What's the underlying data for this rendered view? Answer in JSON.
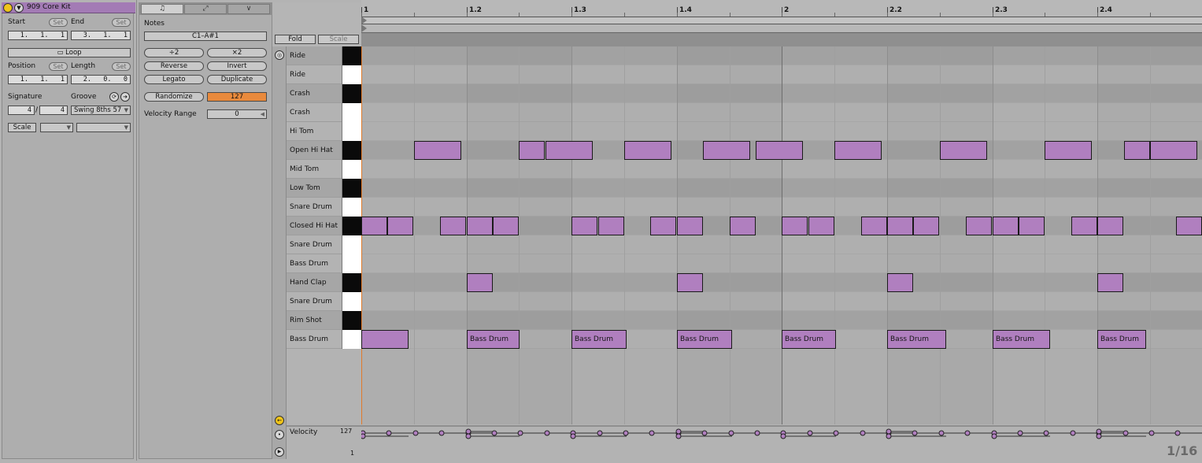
{
  "clip": {
    "title": "909 Core Kit",
    "start_label": "Start",
    "end_label": "End",
    "set": "Set",
    "start_value": "1.   1.   1",
    "end_value": "3.   1.   1",
    "loop_label": "Loop",
    "position_label": "Position",
    "length_label": "Length",
    "position_value": "1.   1.   1",
    "length_value": "2.   0.   0",
    "signature_label": "Signature",
    "groove_label": "Groove",
    "sig_num": "4",
    "sig_den": "4",
    "groove_value": "Swing 8ths 57",
    "scale_label": "Scale",
    "accent": "#a37bb5"
  },
  "notes_panel": {
    "tab_icons": [
      "music-note-icon",
      "expand-icon",
      "envelope-icon"
    ],
    "tab_glyphs": [
      "♫",
      "⤢",
      "∨"
    ],
    "notes_label": "Notes",
    "range_value": "C1–A#1",
    "div2": "÷2",
    "mul2": "×2",
    "reverse": "Reverse",
    "invert": "Invert",
    "legato": "Legato",
    "duplicate": "Duplicate",
    "randomize": "Randomize",
    "randomize_value": "127",
    "velocity_range_label": "Velocity Range",
    "velocity_range_value": "0"
  },
  "editor": {
    "fold": "Fold",
    "scale": "Scale",
    "ruler": [
      "1",
      "1.2",
      "1.3",
      "1.4",
      "2",
      "2.2",
      "2.3",
      "2.4"
    ],
    "grid_label": "1/16",
    "velocity_label": "Velocity",
    "velocity_max": "127",
    "velocity_min": "1"
  },
  "lanes": [
    {
      "name": "Ride",
      "key": "black"
    },
    {
      "name": "Ride",
      "key": "white"
    },
    {
      "name": "Crash",
      "key": "black"
    },
    {
      "name": "Crash",
      "key": "white"
    },
    {
      "name": "Hi Tom",
      "key": "white"
    },
    {
      "name": "Open Hi Hat",
      "key": "black"
    },
    {
      "name": "Mid Tom",
      "key": "white"
    },
    {
      "name": "Low Tom",
      "key": "black"
    },
    {
      "name": "Snare Drum",
      "key": "white"
    },
    {
      "name": "Closed Hi Hat",
      "key": "black"
    },
    {
      "name": "Snare Drum",
      "key": "white"
    },
    {
      "name": "Bass Drum",
      "key": "white"
    },
    {
      "name": "Hand Clap",
      "key": "black"
    },
    {
      "name": "Snare Drum",
      "key": "white"
    },
    {
      "name": "Rim Shot",
      "key": "black"
    },
    {
      "name": "Bass Drum",
      "key": "white"
    }
  ],
  "notes": [
    {
      "lane": 5,
      "start": 1.0,
      "len": 0.9
    },
    {
      "lane": 5,
      "start": 3.0,
      "len": 0.5
    },
    {
      "lane": 5,
      "start": 3.5,
      "len": 0.9
    },
    {
      "lane": 5,
      "start": 5.0,
      "len": 0.9
    },
    {
      "lane": 5,
      "start": 6.5,
      "len": 0.9
    },
    {
      "lane": 5,
      "start": 7.5,
      "len": 0.9
    },
    {
      "lane": 5,
      "start": 9.0,
      "len": 0.9
    },
    {
      "lane": 5,
      "start": 11.0,
      "len": 0.9
    },
    {
      "lane": 5,
      "start": 13.0,
      "len": 0.9
    },
    {
      "lane": 5,
      "start": 14.5,
      "len": 0.5
    },
    {
      "lane": 5,
      "start": 15.0,
      "len": 0.9
    },
    {
      "lane": 9,
      "start": 0.0,
      "len": 0.5
    },
    {
      "lane": 9,
      "start": 0.5,
      "len": 0.5
    },
    {
      "lane": 9,
      "start": 1.5,
      "len": 0.5
    },
    {
      "lane": 9,
      "start": 2.0,
      "len": 0.5
    },
    {
      "lane": 9,
      "start": 2.5,
      "len": 0.5
    },
    {
      "lane": 9,
      "start": 4.0,
      "len": 0.5
    },
    {
      "lane": 9,
      "start": 4.5,
      "len": 0.5
    },
    {
      "lane": 9,
      "start": 5.5,
      "len": 0.5
    },
    {
      "lane": 9,
      "start": 6.0,
      "len": 0.5
    },
    {
      "lane": 9,
      "start": 7.0,
      "len": 0.5
    },
    {
      "lane": 9,
      "start": 8.0,
      "len": 0.5
    },
    {
      "lane": 9,
      "start": 8.5,
      "len": 0.5
    },
    {
      "lane": 9,
      "start": 9.5,
      "len": 0.5
    },
    {
      "lane": 9,
      "start": 10.0,
      "len": 0.5
    },
    {
      "lane": 9,
      "start": 10.5,
      "len": 0.5
    },
    {
      "lane": 9,
      "start": 11.5,
      "len": 0.5
    },
    {
      "lane": 9,
      "start": 12.0,
      "len": 0.5
    },
    {
      "lane": 9,
      "start": 12.5,
      "len": 0.5
    },
    {
      "lane": 9,
      "start": 13.5,
      "len": 0.5
    },
    {
      "lane": 9,
      "start": 14.0,
      "len": 0.5
    },
    {
      "lane": 9,
      "start": 15.5,
      "len": 0.5
    },
    {
      "lane": 12,
      "start": 2.0,
      "len": 0.5
    },
    {
      "lane": 12,
      "start": 6.0,
      "len": 0.5
    },
    {
      "lane": 12,
      "start": 10.0,
      "len": 0.5
    },
    {
      "lane": 12,
      "start": 14.0,
      "len": 0.5
    },
    {
      "lane": 15,
      "start": 0.0,
      "len": 0.9,
      "label": ""
    },
    {
      "lane": 15,
      "start": 2.0,
      "len": 1.0,
      "label": "Bass Drum"
    },
    {
      "lane": 15,
      "start": 4.0,
      "len": 1.05,
      "label": "Bass Drum"
    },
    {
      "lane": 15,
      "start": 6.0,
      "len": 1.05,
      "label": "Bass Drum"
    },
    {
      "lane": 15,
      "start": 8.0,
      "len": 1.03,
      "label": "Bass Drum"
    },
    {
      "lane": 15,
      "start": 10.0,
      "len": 1.13,
      "label": "Bass Drum"
    },
    {
      "lane": 15,
      "start": 12.0,
      "len": 1.1,
      "label": "Bass Drum"
    },
    {
      "lane": 15,
      "start": 14.0,
      "len": 0.93,
      "label": "Bass Drum"
    }
  ]
}
